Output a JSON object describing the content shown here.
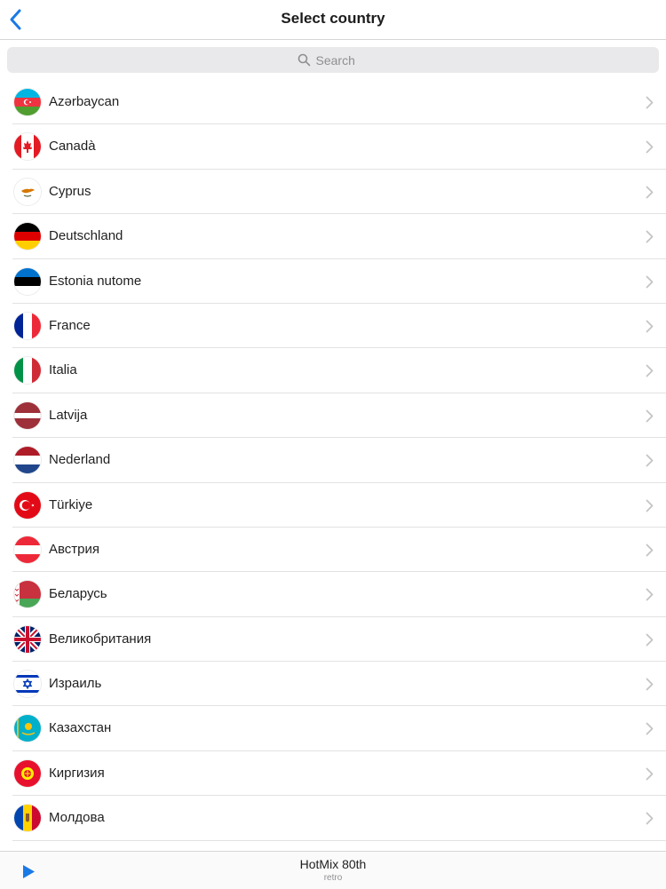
{
  "header": {
    "title": "Select country",
    "back_icon": "chevron-left-icon"
  },
  "search": {
    "placeholder": "Search",
    "icon": "search-icon"
  },
  "countries": [
    {
      "label": "Azərbaycan",
      "flag": "azerbaijan"
    },
    {
      "label": "Canadà",
      "flag": "canada"
    },
    {
      "label": "Cyprus",
      "flag": "cyprus"
    },
    {
      "label": "Deutschland",
      "flag": "germany"
    },
    {
      "label": "Estonia nutome",
      "flag": "estonia"
    },
    {
      "label": "France",
      "flag": "france"
    },
    {
      "label": "Italia",
      "flag": "italy"
    },
    {
      "label": "Latvija",
      "flag": "latvia"
    },
    {
      "label": "Nederland",
      "flag": "netherlands"
    },
    {
      "label": "Türkiye",
      "flag": "turkey"
    },
    {
      "label": "Австрия",
      "flag": "austria"
    },
    {
      "label": "Беларусь",
      "flag": "belarus"
    },
    {
      "label": "Великобритания",
      "flag": "united-kingdom"
    },
    {
      "label": "Израиль",
      "flag": "israel"
    },
    {
      "label": "Казахстан",
      "flag": "kazakhstan"
    },
    {
      "label": "Киргизия",
      "flag": "kyrgyzstan"
    },
    {
      "label": "Молдова",
      "flag": "moldova"
    }
  ],
  "player": {
    "title": "HotMix 80th",
    "subtitle": "retro",
    "play_icon": "play-icon"
  },
  "colors": {
    "accent": "#1a7ae6",
    "separator": "#e2e2e2",
    "search_bg": "#e9e9eb"
  }
}
